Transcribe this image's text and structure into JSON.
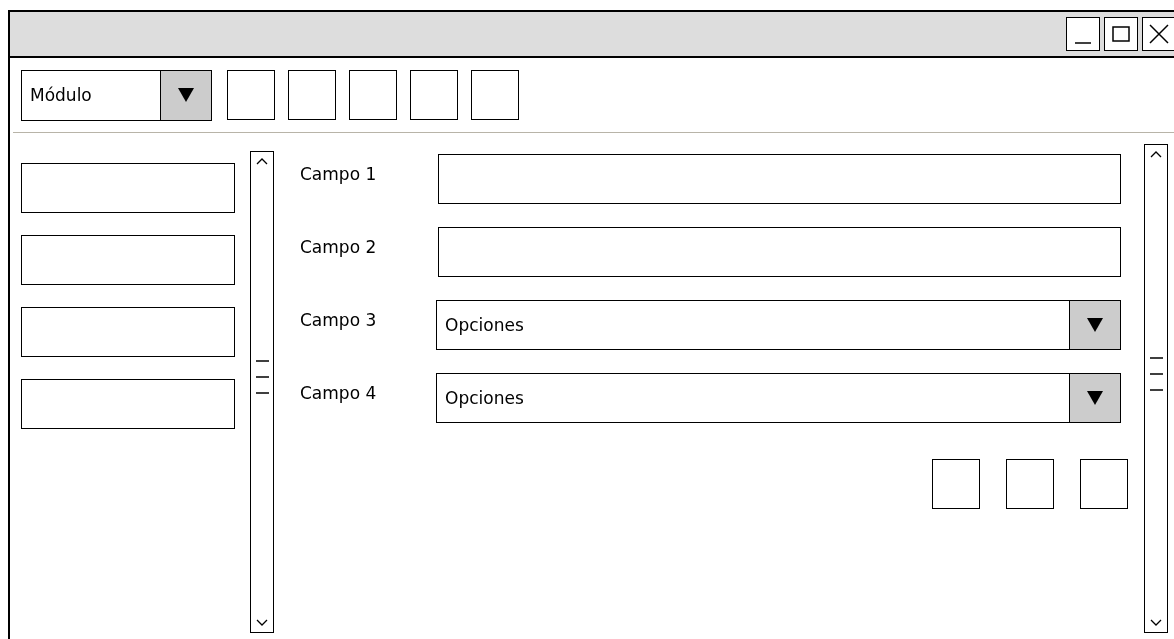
{
  "window": {
    "controls": [
      {
        "kind": "minimize"
      },
      {
        "kind": "maximize"
      },
      {
        "kind": "close"
      }
    ]
  },
  "toolbar": {
    "module_dropdown": {
      "value": "Módulo"
    },
    "buttons": [
      {
        "kind": "blank"
      },
      {
        "kind": "blank"
      },
      {
        "kind": "blank"
      },
      {
        "kind": "blank"
      },
      {
        "kind": "blank"
      }
    ]
  },
  "sidebar": {
    "items": [
      {
        "kind": "blank"
      },
      {
        "kind": "blank"
      },
      {
        "kind": "blank"
      },
      {
        "kind": "blank"
      }
    ]
  },
  "form": {
    "fields": [
      {
        "label": "Campo 1",
        "kind": "text"
      },
      {
        "label": "Campo 2",
        "kind": "text"
      },
      {
        "label": "Campo 3",
        "kind": "dropdown",
        "value": "Opciones"
      },
      {
        "label": "Campo 4",
        "kind": "dropdown",
        "value": "Opciones"
      }
    ],
    "buttons": [
      {
        "kind": "blank"
      },
      {
        "kind": "blank"
      },
      {
        "kind": "blank"
      }
    ]
  }
}
